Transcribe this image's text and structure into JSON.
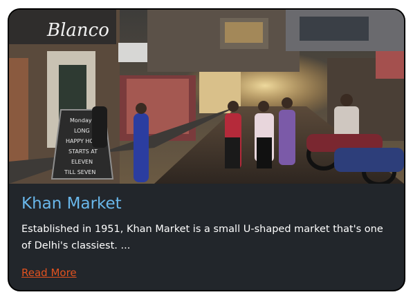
{
  "card": {
    "image_alt": "Khan Market street scene",
    "sign_text": "Blanco",
    "board_lines": [
      "Monday",
      "LONG",
      "HAPPY HOUR",
      "STARTS AT",
      "ELEVEN",
      "TILL SEVEN"
    ],
    "title": "Khan Market",
    "description": "Established in 1951, Khan Market is a small U-shaped market that's one of Delhi's classiest. ...",
    "read_more_label": "Read More"
  },
  "colors": {
    "card_bg": "#22262b",
    "title": "#69b7ea",
    "link": "#e2521f"
  }
}
